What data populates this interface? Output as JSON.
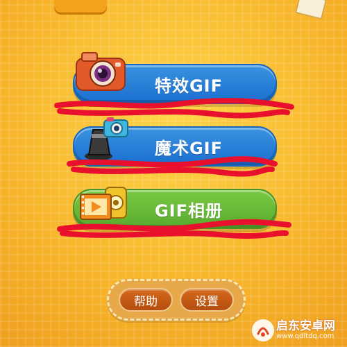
{
  "menu": {
    "buttons": [
      {
        "label": "特效GIF",
        "color": "#1f78d6",
        "icon": "camera-icon"
      },
      {
        "label": "魔术GIF",
        "color": "#1f78d6",
        "icon": "magic-camera-icon"
      },
      {
        "label": "GIF相册",
        "color": "#5fb33a",
        "icon": "film-photo-icon"
      }
    ]
  },
  "bottom": {
    "help_label": "帮助",
    "settings_label": "设置"
  },
  "watermark": {
    "title": "启东安卓网",
    "url": "www.qdltdq.com"
  },
  "colors": {
    "background": "#f6b928",
    "scribble": "#e8102c",
    "bottom_button": "#c45d15"
  }
}
